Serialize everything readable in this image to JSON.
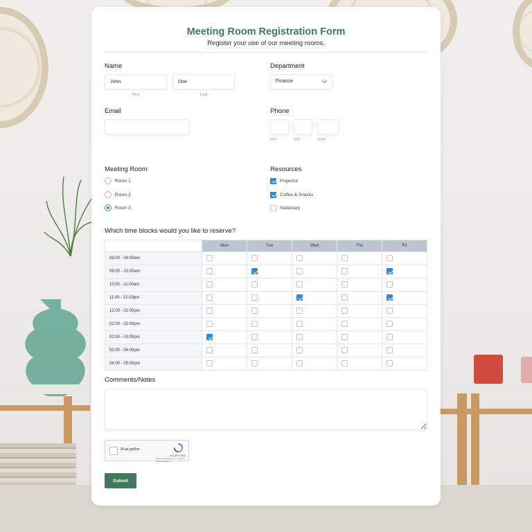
{
  "form": {
    "title": "Meeting Room Registration Form",
    "subtitle": "Register your use of our meeting rooms."
  },
  "name": {
    "label": "Name",
    "first_value": "John",
    "first_sublabel": "First",
    "last_value": "Doe",
    "last_sublabel": "Last"
  },
  "department": {
    "label": "Department",
    "selected": "Finance"
  },
  "email": {
    "label": "Email",
    "value": ""
  },
  "phone": {
    "label": "Phone",
    "part1_sublabel": "###",
    "part2_sublabel": "###",
    "part3_sublabel": "####",
    "separator": "-"
  },
  "meeting_room": {
    "label": "Meeting Room",
    "options": [
      {
        "label": "Room 1",
        "selected": false
      },
      {
        "label": "Room 2",
        "selected": false
      },
      {
        "label": "Room 3",
        "selected": true
      }
    ]
  },
  "resources": {
    "label": "Resources",
    "options": [
      {
        "label": "Projector",
        "checked": true
      },
      {
        "label": "Coffee & Snacks",
        "checked": true
      },
      {
        "label": "Stationary",
        "checked": false
      }
    ]
  },
  "time_blocks": {
    "question": "Which time blocks would you like to reserve?",
    "days": [
      "Mon",
      "Tue",
      "Wed",
      "Thu",
      "Fri"
    ],
    "rows": [
      {
        "time": "08:00 - 09:00am",
        "checks": [
          false,
          false,
          false,
          false,
          false
        ]
      },
      {
        "time": "09:00 - 10:00am",
        "checks": [
          false,
          true,
          false,
          false,
          true
        ]
      },
      {
        "time": "10:00 - 11:00am",
        "checks": [
          false,
          false,
          false,
          false,
          false
        ]
      },
      {
        "time": "11:00 - 12:00pm",
        "checks": [
          false,
          false,
          true,
          false,
          true
        ]
      },
      {
        "time": "12:00 - 01:00pm",
        "checks": [
          false,
          false,
          false,
          false,
          false
        ]
      },
      {
        "time": "01:00 - 02:00pm",
        "checks": [
          false,
          false,
          false,
          false,
          false
        ]
      },
      {
        "time": "02:00 - 03:00pm",
        "checks": [
          true,
          false,
          false,
          false,
          false
        ]
      },
      {
        "time": "03:00 - 04:00pm",
        "checks": [
          false,
          false,
          false,
          false,
          false
        ]
      },
      {
        "time": "04:00 - 05:00pm",
        "checks": [
          false,
          false,
          false,
          false,
          false
        ]
      }
    ]
  },
  "comments": {
    "label": "Comments/Notes",
    "value": ""
  },
  "captcha": {
    "checkbox_text": "Я не робот",
    "brand": "reCAPTCHA",
    "fine_print": "Конфиденциальность - Условия использования",
    "logo_icon": "recaptcha-logo-icon"
  },
  "submit_label": "Submit",
  "colors": {
    "accent_green": "#3f7a5a",
    "check_blue": "#2f86dd",
    "table_header": "#bcc6d0"
  }
}
